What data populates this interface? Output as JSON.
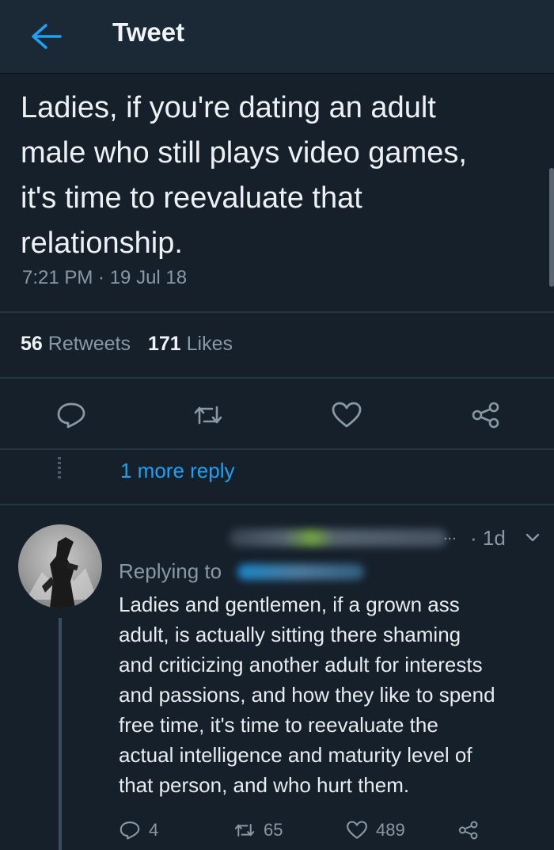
{
  "header": {
    "title": "Tweet",
    "back_icon": "arrow-left-icon"
  },
  "tweet": {
    "lines": [
      "Ladies, if you're dating an adult",
      "male who still plays video games,",
      "it's time to reevaluate that",
      "relationship."
    ],
    "timestamp": "7:21 PM · 19 Jul 18",
    "retweets_count": "56",
    "retweets_label": "Retweets",
    "likes_count": "171",
    "likes_label": "Likes",
    "actions": [
      "reply-icon",
      "retweet-icon",
      "like-icon",
      "share-icon"
    ]
  },
  "thread": {
    "more_replies": "1 more reply"
  },
  "reply": {
    "ellipsis": "...",
    "age": "· 1d",
    "replying_to": "Replying to",
    "lines": [
      "Ladies and gentlemen, if a grown ass",
      "adult, is actually sitting there shaming",
      "and criticizing another adult for interests",
      "and passions, and how they like to spend",
      "free time, it's time to reevaluate the",
      "actual intelligence and maturity level of",
      "that person, and who hurt them."
    ],
    "replies": "4",
    "retweets": "65",
    "likes": "489"
  },
  "colors": {
    "background": "#15202b",
    "accent": "#1da1f2",
    "muted": "#8899a6"
  }
}
